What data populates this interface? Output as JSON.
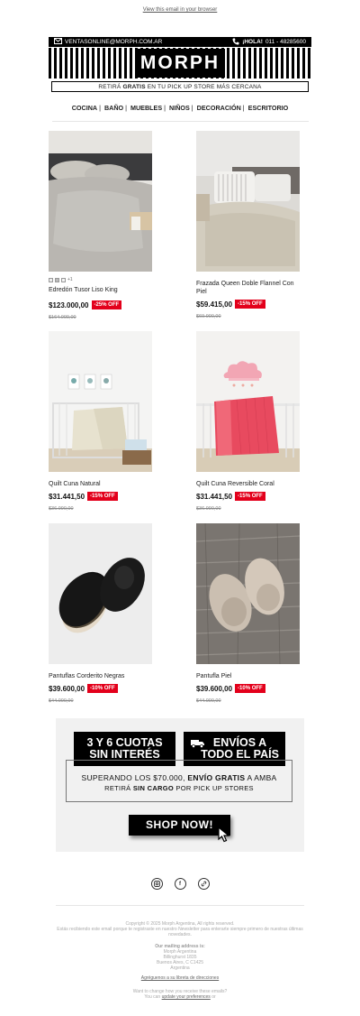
{
  "preheader": {
    "link": "View this email in your browser"
  },
  "topbar": {
    "email": "VENTASONLINE@MORPH.COM.AR",
    "hello": "¡HOLA!",
    "phone": " 011 - 48285600"
  },
  "logo": "MORPH",
  "pickup": {
    "pre": "RETIRÁ",
    "bold": "GRATIS",
    "post": "EN TU PICK UP STORE MÁS CERCANA"
  },
  "nav": [
    "COCINA",
    "BAÑO",
    "MUEBLES",
    "NIÑOS",
    "DECORACIÓN",
    "ESCRITORIO"
  ],
  "products": [
    {
      "name": "Edredón Tusor Liso King",
      "price": "$123.000,00",
      "badge": "-25% OFF",
      "old": "$164.000,00",
      "swatches_more": "+1"
    },
    {
      "name": "Frazada Queen Doble Flannel Con Piel",
      "price": "$59.415,00",
      "badge": "-15% OFF",
      "old": "$69.900,00"
    },
    {
      "name": "Quilt Cuna Natural",
      "price": "$31.441,50",
      "badge": "-15% OFF",
      "old": "$36.990,00"
    },
    {
      "name": "Quilt Cuna Reversible Coral",
      "price": "$31.441,50",
      "badge": "-15% OFF",
      "old": "$36.990,00"
    },
    {
      "name": "Pantuflas Corderito Negras",
      "price": "$39.600,00",
      "badge": "-10% OFF",
      "old": "$44.000,00"
    },
    {
      "name": "Pantufla Piel",
      "price": "$39.600,00",
      "badge": "-10% OFF",
      "old": "$44.000,00"
    }
  ],
  "promo": {
    "cuotas_1": "3 Y 6 CUOTAS",
    "cuotas_2": "SIN INTERÉS",
    "envios_1": "ENVÍOS A",
    "envios_2": "TODO EL PAÍS",
    "line1_pre": "SUPERANDO LOS $70.000, ",
    "line1_bold": "ENVÍO GRATIS",
    "line1_post": " A AMBA",
    "line2_pre": "RETIRÁ ",
    "line2_bold": "SIN CARGO",
    "line2_post": " POR PICK UP STORES",
    "cta": "SHOP NOW!"
  },
  "social_icons": [
    "instagram-icon",
    "facebook-icon",
    "website-icon"
  ],
  "footer": {
    "copyright": "Copyright © 2025 Morph Argentina, All rights reserved.",
    "reason": "Estás recibiendo este email porque te registraste en nuestro Newsletter para enterarte siempre primero de nuestras últimas novedades.",
    "mailing_title": "Our mailing address is:",
    "addr1": "Morph Argentina",
    "addr2": "Billinghurst 1835",
    "addr3": "Buenos Aires, C C1425",
    "addr4": "Argentina",
    "add_contact": "Agréguenos a su libreta de direcciones",
    "change": "Want to change how you receive these emails?",
    "update_pre": "You can ",
    "update_link": "update your preferences",
    "update_post": " or"
  }
}
